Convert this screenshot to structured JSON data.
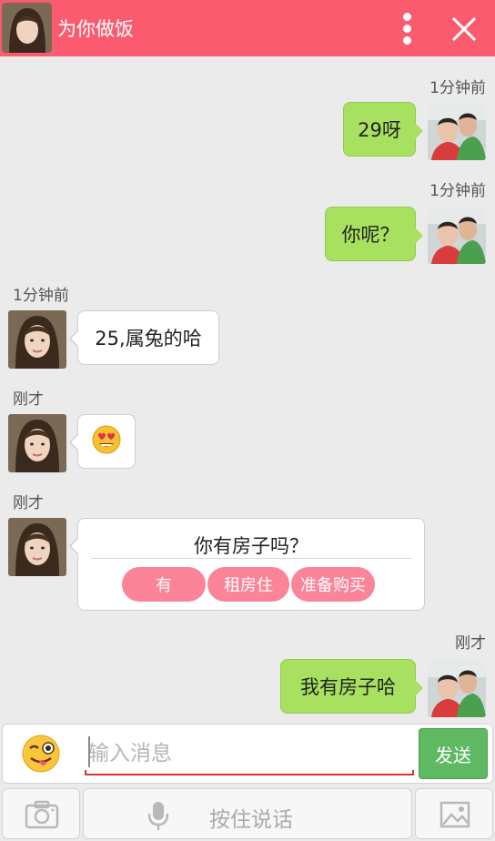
{
  "header": {
    "title": "为你做饭",
    "color": "#fb5b6f"
  },
  "messages": [
    {
      "side": "me",
      "time": "1分钟前",
      "text": "29呀"
    },
    {
      "side": "me",
      "time": "1分钟前",
      "text": "你呢？"
    },
    {
      "side": "her",
      "time": "1分钟前",
      "text": "25,属兔的哈"
    },
    {
      "side": "her",
      "time": "刚才",
      "emoji": "heart-eyes-face"
    },
    {
      "side": "her",
      "time": "刚才",
      "question": "你有房子吗？",
      "options": [
        "有",
        "租房住",
        "准备购买"
      ]
    },
    {
      "side": "me",
      "time": "刚才",
      "text": "我有房子哈"
    }
  ],
  "input": {
    "placeholder": "输入消息",
    "send_label": "发送"
  },
  "toolbar": {
    "voice_label": "按住说话"
  },
  "colors": {
    "my_bubble": "#a8e05f",
    "option_pill": "#fb8498",
    "send_button": "#5fb962"
  }
}
